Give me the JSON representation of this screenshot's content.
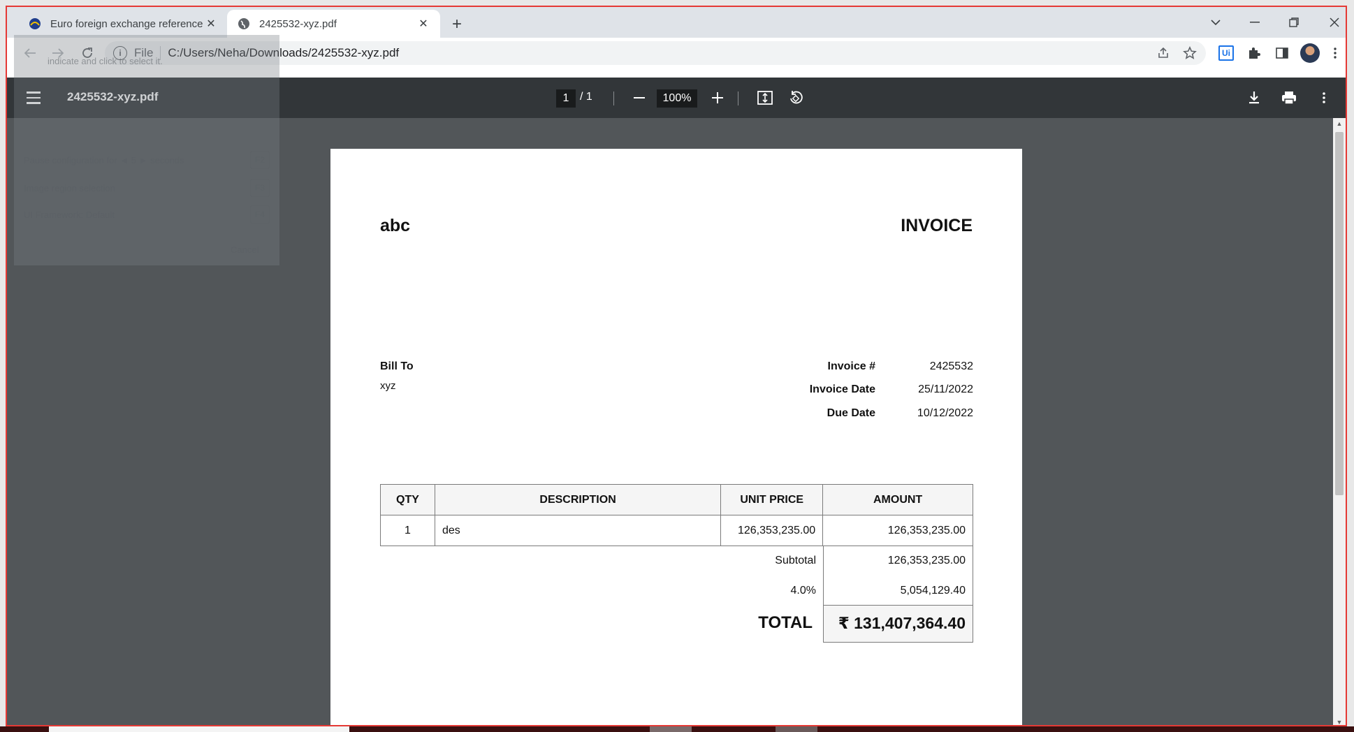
{
  "browser": {
    "tabs": [
      {
        "title": "Euro foreign exchange reference",
        "active": false
      },
      {
        "title": "2425532-xyz.pdf",
        "active": true
      }
    ],
    "address": {
      "scheme": "File",
      "url": "C:/Users/Neha/Downloads/2425532-xyz.pdf"
    },
    "extension_badge": "Ui"
  },
  "ghost_panel": {
    "lines": [
      "indicate and click to select it.",
      "Pause configuration for ◄ 5 ► seconds",
      "Image region selection",
      "UI Framework: Default",
      "Cancel"
    ],
    "keys": [
      "F2",
      "F3",
      "F4"
    ]
  },
  "pdf_viewer": {
    "filename": "2425532-xyz.pdf",
    "current_page": "1",
    "page_total": "/ 1",
    "zoom": "100%"
  },
  "invoice": {
    "company": "abc",
    "title": "INVOICE",
    "bill_to_label": "Bill To",
    "bill_to_name": "xyz",
    "meta": [
      {
        "label": "Invoice #",
        "value": "2425532"
      },
      {
        "label": "Invoice Date",
        "value": "25/11/2022"
      },
      {
        "label": "Due Date",
        "value": "10/12/2022"
      }
    ],
    "columns": [
      "QTY",
      "DESCRIPTION",
      "UNIT PRICE",
      "AMOUNT"
    ],
    "rows": [
      {
        "qty": "1",
        "description": "des",
        "unit_price": "126,353,235.00",
        "amount": "126,353,235.00"
      }
    ],
    "subtotal_label": "Subtotal",
    "subtotal_value": "126,353,235.00",
    "tax_label": "4.0%",
    "tax_value": "5,054,129.40",
    "total_label": "TOTAL",
    "total_value": "₹ 131,407,364.40"
  },
  "colors": {
    "frame": "#e53935",
    "pdf_toolbar": "#323639",
    "pdf_canvas": "#525659",
    "accent": "#1a73e8"
  }
}
